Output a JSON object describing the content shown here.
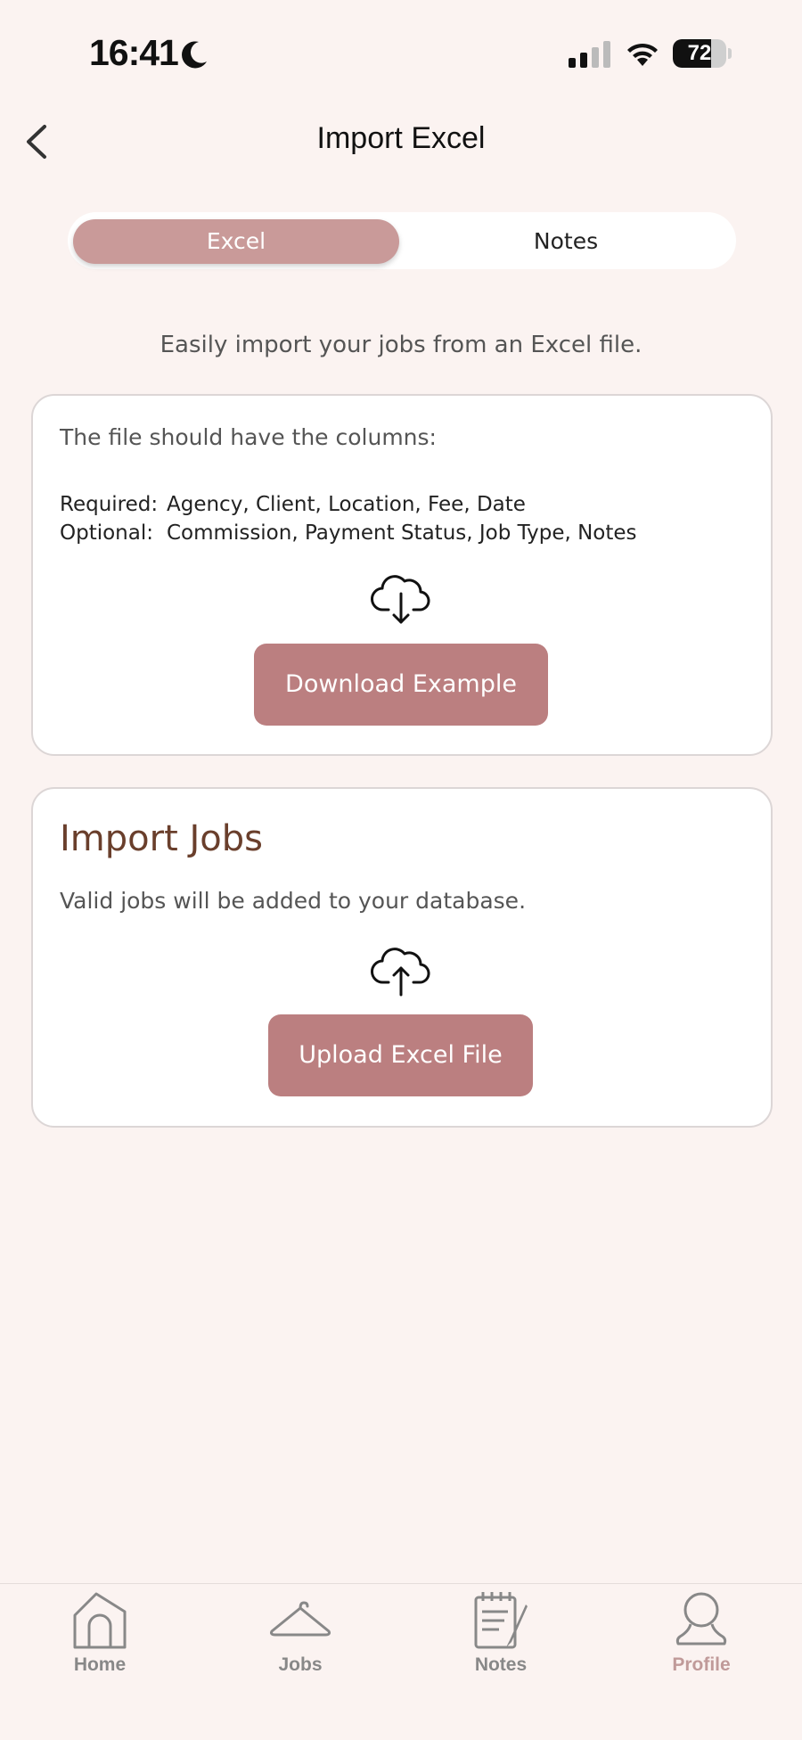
{
  "status_bar": {
    "time": "16:41",
    "battery": "72",
    "battery_level": 0.72
  },
  "header": {
    "title": "Import Excel"
  },
  "segmented": {
    "excel_label": "Excel",
    "notes_label": "Notes",
    "selected": "Excel"
  },
  "intro_text": "Easily import your jobs from an Excel file.",
  "columns_card": {
    "intro": "The file should have the columns:",
    "required_label": "Required:",
    "required_value": "Agency, Client, Location, Fee, Date",
    "optional_label": "Optional:",
    "optional_value": "Commission, Payment Status, Job Type, Notes",
    "download_label": "Download Example"
  },
  "import_card": {
    "title": "Import Jobs",
    "description": "Valid jobs will be added to your database.",
    "upload_label": "Upload Excel File"
  },
  "bottom_nav": {
    "items": [
      {
        "label": "Home",
        "icon": "home-icon"
      },
      {
        "label": "Jobs",
        "icon": "hanger-icon"
      },
      {
        "label": "Notes",
        "icon": "notepad-icon"
      },
      {
        "label": "Profile",
        "icon": "person-icon"
      }
    ],
    "active": "Profile"
  },
  "colors": {
    "accent": "#bb7f80",
    "segment_active": "#c99a99",
    "title_brown": "#6a3f2c",
    "background": "#fbf3f1",
    "nav_active": "#c09a99"
  }
}
